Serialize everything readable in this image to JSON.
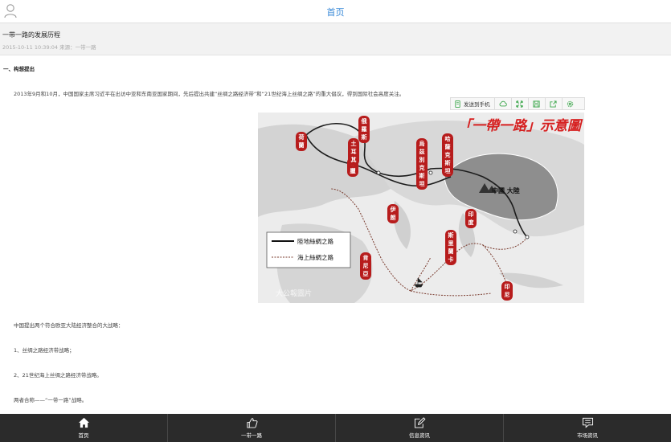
{
  "header": {
    "title": "首页",
    "user_icon": "user-icon"
  },
  "article": {
    "title": "一带一路的发展历程",
    "meta": "2015-10-11 10:39:04 来源：一带一路"
  },
  "content": {
    "section_heading": "一、构想提出",
    "para1": "2013年9月和10月，中国国家主席习近平在出访中亚和东南亚国家期间，先后提出共建“丝绸之路经济带”和“21世纪海上丝绸之路”的重大倡议，得到国际社会高度关注。",
    "toolbar": {
      "send_label": "发送到手机",
      "icons": [
        "send-phone-icon",
        "cloud-icon",
        "expand-icon",
        "save-icon",
        "share-icon",
        "settings-icon"
      ]
    },
    "map": {
      "title": "「一帶一路」示意圖",
      "places": [
        "荷蘭",
        "俄羅斯",
        "希臘",
        "土耳其",
        "烏茲別克斯坦",
        "哈薩克斯坦",
        "伊朗",
        "肯尼亞",
        "印度",
        "斯里蘭卡",
        "印尼",
        "中國 大陸"
      ],
      "legend_land": "陸地絲綢之路",
      "legend_sea": "海上絲綢之路",
      "watermark": "大公報圖片"
    },
    "line1": "中国提出两个符合欧亚大陆经济整合的大战略：",
    "line2": "1、丝绸之路经济带战略；",
    "line3": "2、21世纪海上丝绸之路经济带战略。",
    "line4": "两者合称——“一带一路”战略。"
  },
  "nav": {
    "items": [
      {
        "label": "首页",
        "icon": "home-icon"
      },
      {
        "label": "一带一路",
        "icon": "thumbs-up-icon"
      },
      {
        "label": "信息资讯",
        "icon": "edit-icon"
      },
      {
        "label": "市场资讯",
        "icon": "message-icon"
      }
    ]
  }
}
